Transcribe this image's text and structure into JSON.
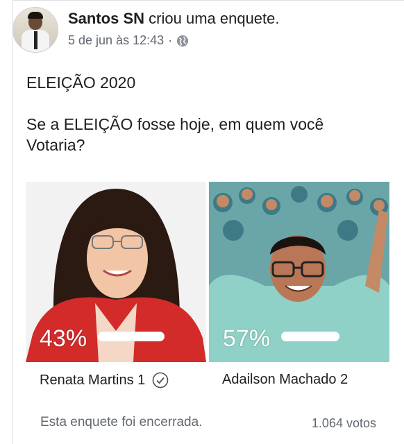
{
  "post": {
    "author": "Santos SN",
    "action": "criou uma enquete.",
    "time": "5 de jun às 12:43",
    "separator": "·",
    "privacy_icon": "globe-icon",
    "title": "ELEIÇÃO 2020",
    "question": "Se a ELEIÇÃO fosse hoje, em quem você Votaria?"
  },
  "poll": {
    "options": [
      {
        "percent_label": "43%",
        "percent": 43,
        "name": "Renata Martins 1",
        "selected": true
      },
      {
        "percent_label": "57%",
        "percent": 57,
        "name": "Adailson Machado 2",
        "selected": false
      }
    ],
    "status": "Esta enquete foi encerrada.",
    "votes": "1.064 votos"
  },
  "colors": {
    "red_jacket": "#d32a2a",
    "crowd_teal": "#6aa6a8",
    "muted_text": "#616770"
  }
}
